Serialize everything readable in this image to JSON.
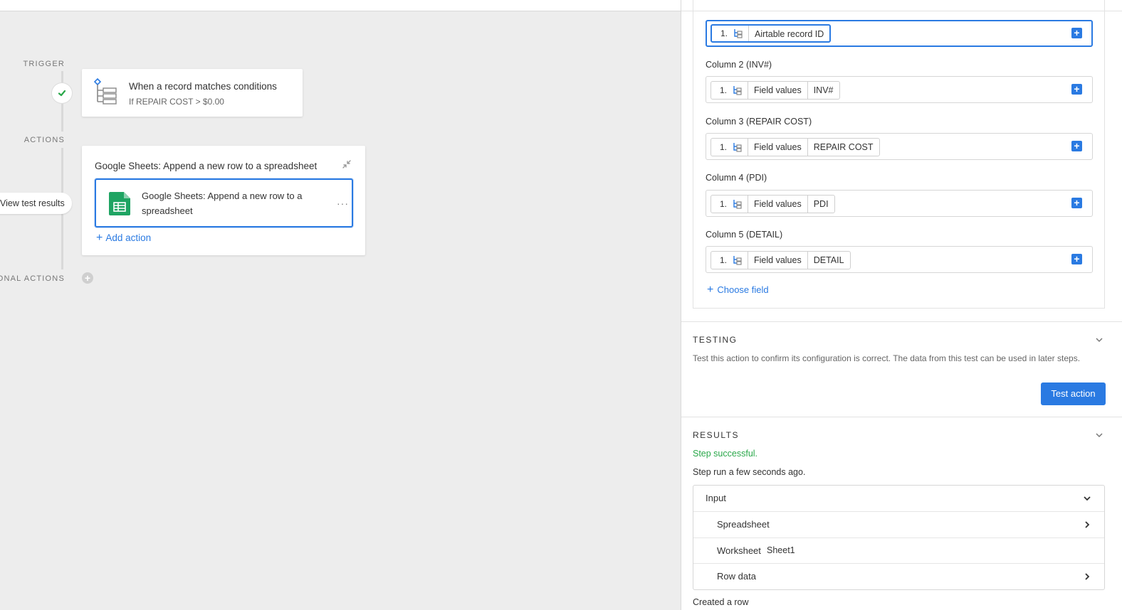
{
  "canvas": {
    "labels": {
      "trigger": "TRIGGER",
      "actions": "ACTIONS",
      "optional": "OPTIONAL ACTIONS"
    },
    "trigger": {
      "title": "When a record matches conditions",
      "subtitle": "If REPAIR COST > $0.00"
    },
    "actions": {
      "title": "Google Sheets: Append a new row to a spreadsheet",
      "item_label": "Google Sheets: Append a new row to a spreadsheet",
      "add_action": "Add action"
    },
    "view_test_results": "View test results"
  },
  "panel": {
    "fields": [
      {
        "label": "",
        "num": "1.",
        "segments": [
          "Airtable record ID"
        ]
      },
      {
        "label": "Column 2 (INV#)",
        "num": "1.",
        "segments": [
          "Field values",
          "INV#"
        ]
      },
      {
        "label": "Column 3 (REPAIR COST)",
        "num": "1.",
        "segments": [
          "Field values",
          "REPAIR COST"
        ]
      },
      {
        "label": "Column 4 (PDI)",
        "num": "1.",
        "segments": [
          "Field values",
          "PDI"
        ]
      },
      {
        "label": "Column 5 (DETAIL)",
        "num": "1.",
        "segments": [
          "Field values",
          "DETAIL"
        ]
      }
    ],
    "choose_field": "Choose field",
    "testing": {
      "title": "TESTING",
      "description": "Test this action to confirm its configuration is correct. The data from this test can be used in later steps.",
      "button": "Test action"
    },
    "results": {
      "title": "RESULTS",
      "status": "Step successful.",
      "run_time": "Step run a few seconds ago.",
      "rows": [
        {
          "label": "Input",
          "value": ""
        },
        {
          "label": "Spreadsheet",
          "value": ""
        },
        {
          "label": "Worksheet",
          "value": "Sheet1"
        },
        {
          "label": "Row data",
          "value": ""
        }
      ],
      "created": "Created a row"
    }
  },
  "colors": {
    "accent": "#2a7ae2",
    "success": "#2aa84a",
    "canvas_bg": "#ededed"
  }
}
